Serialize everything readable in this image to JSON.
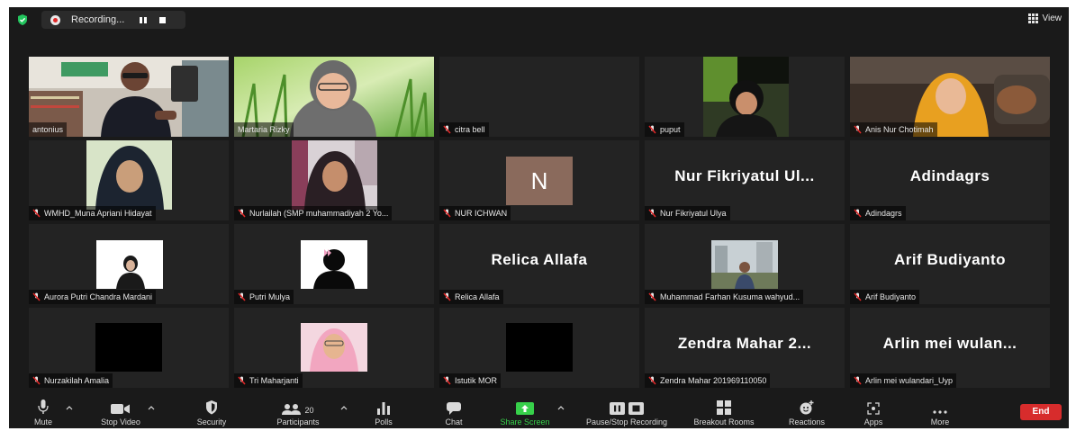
{
  "recording": {
    "label": "Recording..."
  },
  "view": {
    "label": "View"
  },
  "tiles": [
    {
      "name": "antonius"
    },
    {
      "name": "Martaria Rizky"
    },
    {
      "name": "citra bell"
    },
    {
      "name": "puput"
    },
    {
      "name": "Anis Nur Chotimah"
    },
    {
      "name": "WMHD_Muna Apriani Hidayat"
    },
    {
      "name": "Nurlailah (SMP muhammadiyah 2 Yo..."
    },
    {
      "name": "NUR ICHWAN",
      "initial": "N"
    },
    {
      "name": "Nur Fikriyatul Ulya",
      "display": "Nur Fikriyatul Ul..."
    },
    {
      "name": "Adindagrs",
      "display": "Adindagrs"
    },
    {
      "name": "Aurora Putri Chandra Mardani"
    },
    {
      "name": "Putri Mulya"
    },
    {
      "name": "Relica Allafa",
      "display": "Relica Allafa"
    },
    {
      "name": "Muhammad Farhan Kusuma wahyud..."
    },
    {
      "name": "Arif Budiyanto",
      "display": "Arif Budiyanto"
    },
    {
      "name": "Nurzakilah Amalia"
    },
    {
      "name": "Tri Maharjanti"
    },
    {
      "name": "Istutik MOR"
    },
    {
      "name": "Zendra Mahar 201969110050",
      "display": "Zendra Mahar 2..."
    },
    {
      "name": "Arlin mei wulandari_Uyp",
      "display": "Arlin mei wulan..."
    }
  ],
  "toolbar": {
    "mute": "Mute",
    "stop_video": "Stop Video",
    "security": "Security",
    "participants": "Participants",
    "participants_count": "20",
    "polls": "Polls",
    "chat": "Chat",
    "share_screen": "Share Screen",
    "pause_recording": "Pause/Stop Recording",
    "breakout_rooms": "Breakout Rooms",
    "reactions": "Reactions",
    "apps": "Apps",
    "more": "More",
    "end": "End"
  },
  "colors": {
    "background": "#1a1a1a",
    "tile": "#232323",
    "active_speaker": "#c8de47",
    "share_green": "#37d04a",
    "end_red": "#d72c2c"
  }
}
